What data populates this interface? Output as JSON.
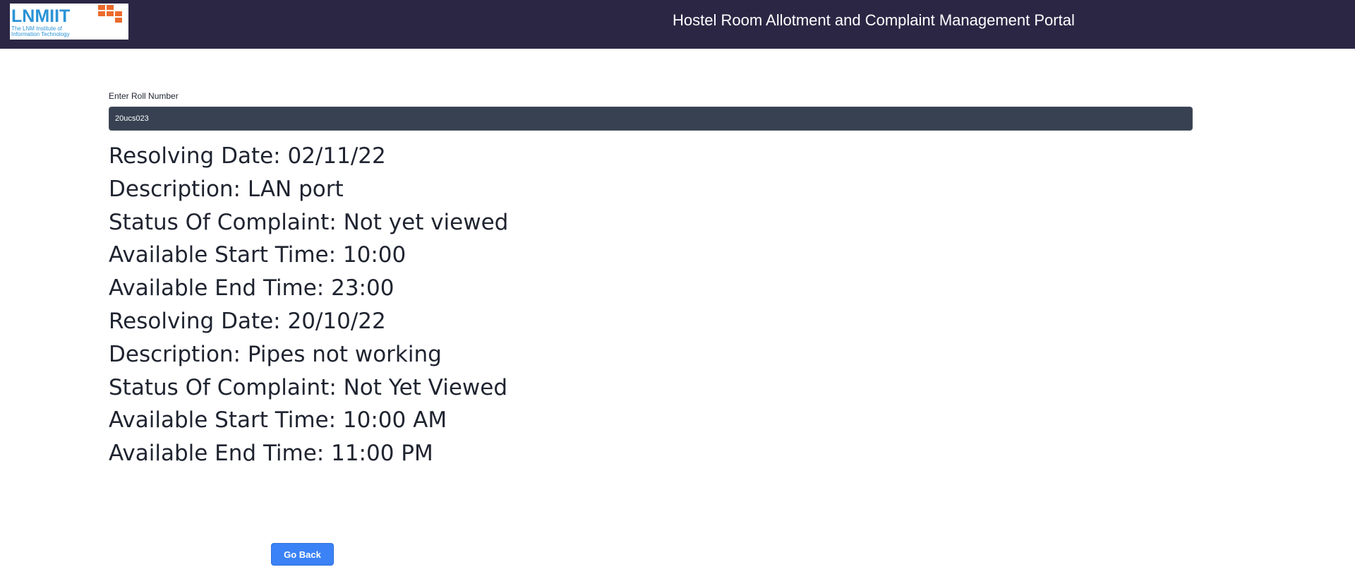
{
  "header": {
    "logo": {
      "word": "LNMIIT",
      "sub_line_1": "The LNM Institute of",
      "sub_line_2": "Information Technology",
      "accent_color": "#ec6a2c",
      "text_color": "#2b93d6"
    },
    "title": "Hostel Room Allotment and Complaint Management Portal",
    "background_color": "#2c2645"
  },
  "roll_field": {
    "label": "Enter Roll Number",
    "value": "20ucs023"
  },
  "complaints": [
    {
      "resolving_date": "Resolving Date: 02/11/22",
      "description": "Description: LAN port",
      "status": "Status Of Complaint: Not yet viewed",
      "start_time": "Available Start Time: 10:00",
      "end_time": "Available End Time: 23:00"
    },
    {
      "resolving_date": "Resolving Date: 20/10/22",
      "description": "Description: Pipes not working",
      "status": "Status Of Complaint: Not Yet Viewed",
      "start_time": "Available Start Time: 10:00 AM",
      "end_time": "Available End Time: 11:00 PM"
    }
  ],
  "actions": {
    "go_back_label": "Go Back",
    "button_color": "#3b82f6"
  }
}
